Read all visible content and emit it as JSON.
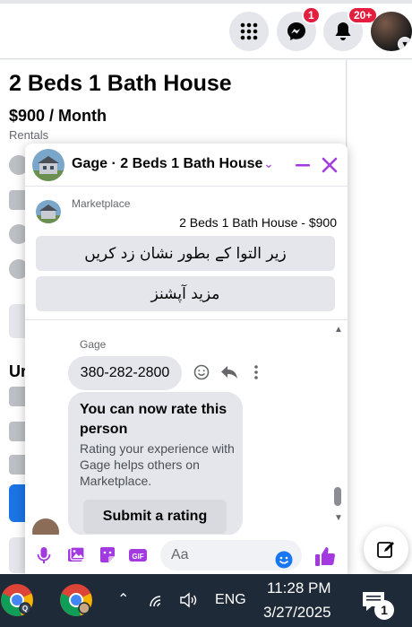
{
  "topbar": {
    "messenger_badge": "1",
    "notifications_badge": "20+"
  },
  "listing": {
    "title": "2 Beds 1 Bath House",
    "price": "$900 / Month",
    "category": "Rentals",
    "section_fragment": "Ur"
  },
  "chat": {
    "header_name": "Gage · 2 Beds 1 Bath House",
    "marketplace_label": "Marketplace",
    "listing_summary": "2 Beds 1 Bath House - $900",
    "action_buttons": [
      "زیر التوا کے بطور نشان زد کریں",
      "مزید آپشنز"
    ],
    "sender_name": "Gage",
    "phone_message": "380-282-2800",
    "rate_card": {
      "title": "You can now rate this person",
      "description": "Rating your experience with Gage helps others on Marketplace.",
      "button_label": "Submit a rating"
    },
    "composer_placeholder": "Aa",
    "accent_color": "#a33ae0"
  },
  "taskbar": {
    "language": "ENG",
    "time": "11:28 PM",
    "date": "3/27/2025",
    "notification_count": "1"
  },
  "icons": {
    "top": [
      "grid-menu-icon",
      "messenger-icon",
      "bell-icon",
      "account-avatar"
    ],
    "composer": [
      "microphone-icon",
      "image-icon",
      "sticker-icon",
      "gif-icon",
      "emoji-icon",
      "thumbs-up-icon"
    ],
    "taskbar": [
      "chrome-icon",
      "chevron-up-icon",
      "wifi-icon",
      "speaker-icon",
      "notification-icon"
    ]
  }
}
